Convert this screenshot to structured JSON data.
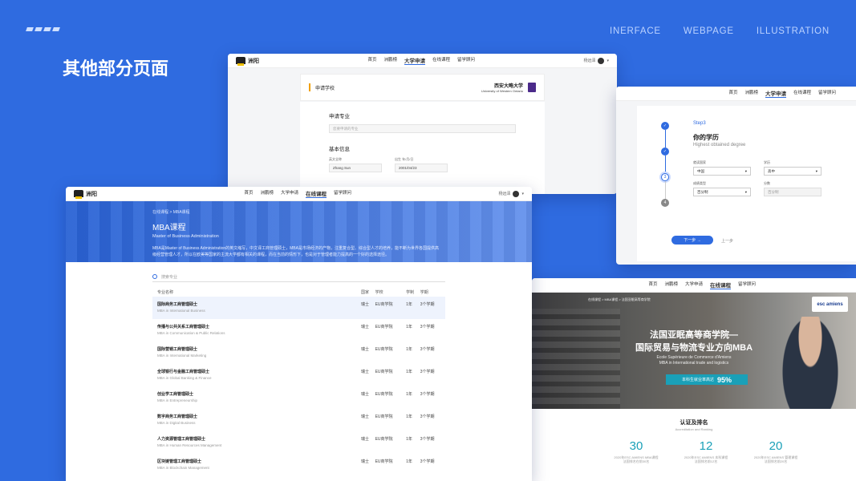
{
  "header": {
    "nav": [
      "INERFACE",
      "WEBPAGE",
      "ILLUSTRATION"
    ],
    "headline": "其他部分页面"
  },
  "common": {
    "brand": "洲阳",
    "user": "杨远泽",
    "nav": [
      "首页",
      "洲鹏榜",
      "大学申请",
      "在线课程",
      "留学顾问"
    ]
  },
  "apply_window": {
    "title": "申请学校",
    "uni_cn": "西安大略大学",
    "uni_en": "University of Western Ontario",
    "major_label": "申请专业",
    "major_placeholder": "您要申请的专业",
    "basic_label": "基本信息",
    "name_label": "英文全称",
    "name_value": "Zhang Sun",
    "dob_label": "出生 年/月/日",
    "dob_value": "2001/04/23"
  },
  "step_window": {
    "step": "Step3",
    "title": "你的学历",
    "subtitle": "Highest obtained degree",
    "country_label": "就读国家",
    "country_value": "中国",
    "degree_label": "学历",
    "degree_value": "高中",
    "score_type_label": "成绩类型",
    "score_type_value": "百分制",
    "score_label": "分数",
    "score_placeholder": "百分制",
    "step4": "4",
    "step3": "3",
    "next": "下一步 →",
    "prev": "上一步"
  },
  "mba_window": {
    "breadcrumb": "在线课程 > MBA课程",
    "title": "MBA课程",
    "subtitle": "Master of Business Administration",
    "desc": "MBA是Master of Business Administration的英文缩写，中文译工商管理硕士，MBA是市场经济的产物，注重复合型、综合型人才的培养，能不断为世界各国提供高级经营管理人才，所以在欧美等国家的主流大学都有相关的课程，而在当前的情形下，也是对于管理者能力提高的一个好的选择途径。",
    "search_placeholder": "搜索专业",
    "columns": [
      "专业名称",
      "国家",
      "学校",
      "学制",
      "学期"
    ],
    "rows": [
      {
        "name": "国际商务工商管理硕士",
        "en": "MBA in International Business",
        "country": "瑞士",
        "school": "EU商学院",
        "duration": "1年",
        "terms": "3个学期"
      },
      {
        "name": "传播与公共关系工商管理硕士",
        "en": "MBA in Communication & Public Relations",
        "country": "瑞士",
        "school": "EU商学院",
        "duration": "1年",
        "terms": "3个学期"
      },
      {
        "name": "国际营销工商管理硕士",
        "en": "MBA in International Marketing",
        "country": "瑞士",
        "school": "EU商学院",
        "duration": "1年",
        "terms": "3个学期"
      },
      {
        "name": "全球银行与金融工商管理硕士",
        "en": "MBA in Global Banking & Finance",
        "country": "瑞士",
        "school": "EU商学院",
        "duration": "1年",
        "terms": "3个学期"
      },
      {
        "name": "创业学工商管理硕士",
        "en": "MBA in Entrepreneurship",
        "country": "瑞士",
        "school": "EU商学院",
        "duration": "1年",
        "terms": "3个学期"
      },
      {
        "name": "数字商务工商管理硕士",
        "en": "MBA in Digital Business",
        "country": "瑞士",
        "school": "EU商学院",
        "duration": "1年",
        "terms": "3个学期"
      },
      {
        "name": "人力资源管理工商管理硕士",
        "en": "MBA in Human Resources Management",
        "country": "瑞士",
        "school": "EU商学院",
        "duration": "1年",
        "terms": "3个学期"
      },
      {
        "name": "区块链管理工商管理硕士",
        "en": "MBA in Blockchain Management",
        "country": "瑞士",
        "school": "EU商学院",
        "duration": "1年",
        "terms": "3个学期"
      }
    ]
  },
  "esc_window": {
    "breadcrumb": "在线课程 > MBA课程 > 法国亚眠高等商学院",
    "logo": "esc amiens",
    "title1": "法国亚眠高等商学院—",
    "title2": "国际贸易与物流专业方向MBA",
    "sub1": "Ecole Supérieure de Commerce d'Amiens",
    "sub2": "MBA in International trade and logistics",
    "badge_label": "本科生就业率高达",
    "badge_value": "95%",
    "section_title": "认证及排名",
    "section_sub": "Accreditation and Ranking",
    "stats": [
      {
        "value": "30",
        "desc": "2020年ESC AMIENS MBA课程\n法国排名在前30名"
      },
      {
        "value": "12",
        "desc": "2020年ESC AMIENS 本科课程\n法国排名前12名"
      },
      {
        "value": "20",
        "desc": "2020年ESC AMIENS 管理课程\n法国排名前20名"
      }
    ]
  }
}
